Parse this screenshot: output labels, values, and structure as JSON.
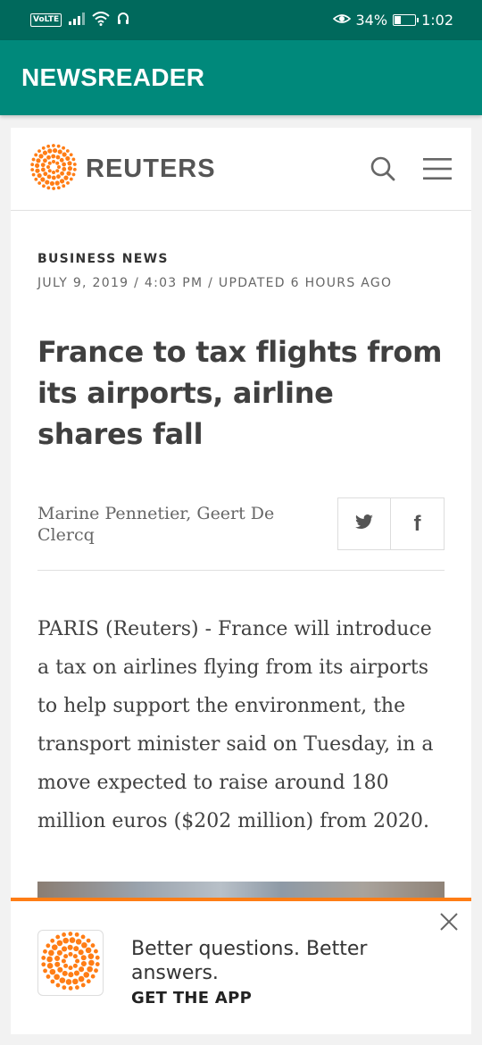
{
  "status_bar": {
    "volte": "VoLTE",
    "battery_percent": "34%",
    "battery_level": 0.34,
    "time": "1:02",
    "icons": [
      "signal-icon",
      "wifi-icon",
      "headset-icon",
      "eye-comfort-icon",
      "battery-icon"
    ]
  },
  "app_bar": {
    "title": "NEWSREADER"
  },
  "site": {
    "brand": "REUTERS",
    "icons": [
      "reuters-logo-icon",
      "search-icon",
      "menu-icon"
    ]
  },
  "article": {
    "section": "BUSINESS NEWS",
    "dateline": "JULY 9, 2019 / 4:03 PM / UPDATED 6 HOURS AGO",
    "headline": "France to tax flights from its airports, airline shares fall",
    "byline": "Marine Pennetier, Geert De Clercq",
    "share_icons": [
      "twitter-icon",
      "facebook-icon"
    ],
    "body": "PARIS (Reuters) - France will introduce a tax on airlines flying from its airports to help support the environment, the transport minister said on Tuesday, in a move expected to raise around 180 million euros ($202 million) from 2020."
  },
  "promo": {
    "line": "Better questions. Better answers.",
    "cta": "GET THE APP",
    "icons": [
      "close-icon",
      "reuters-logo-icon"
    ]
  },
  "colors": {
    "status_bar": "#00695c",
    "app_bar": "#00897b",
    "reuters_orange": "#ff7d15",
    "text_dark": "#404040"
  }
}
